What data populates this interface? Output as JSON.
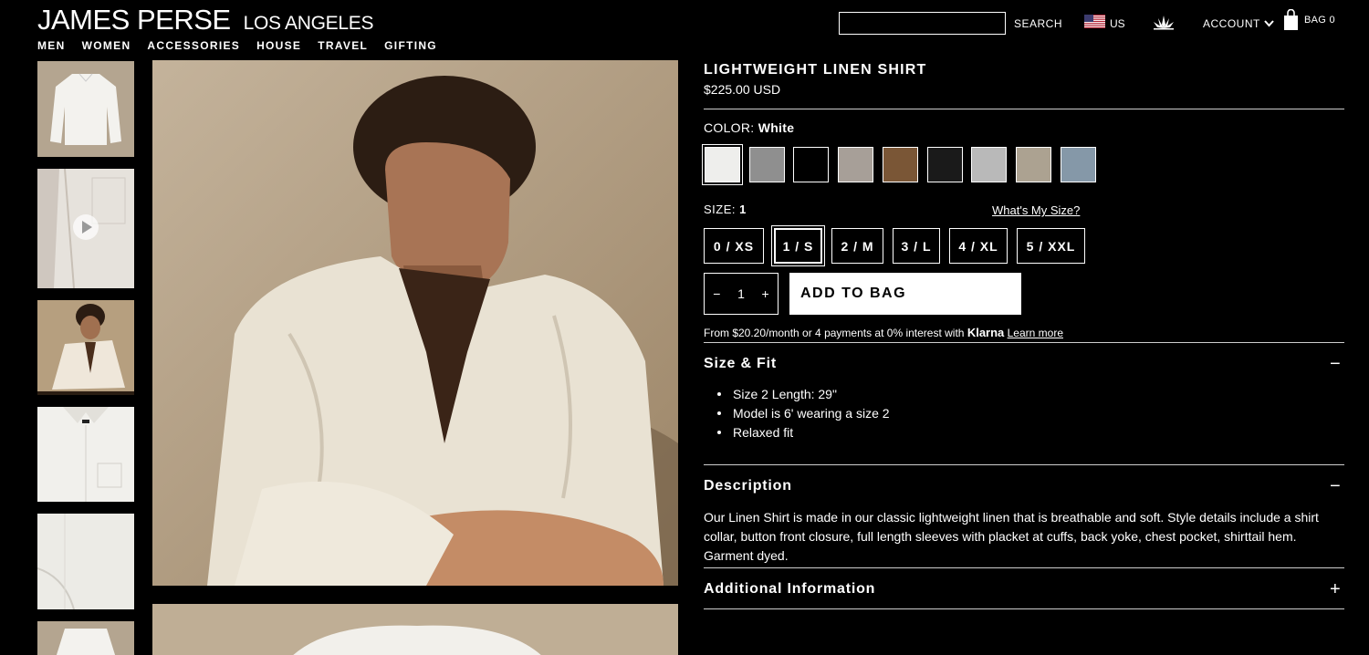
{
  "brand": {
    "name": "JAMES PERSE",
    "sub": "LOS ANGELES"
  },
  "nav": [
    "MEN",
    "WOMEN",
    "ACCESSORIES",
    "HOUSE",
    "TRAVEL",
    "GIFTING"
  ],
  "header": {
    "search_value": "",
    "search_label": "SEARCH",
    "region": "US",
    "account": "ACCOUNT",
    "bag": "BAG 0"
  },
  "product": {
    "title": "LIGHTWEIGHT LINEN SHIRT",
    "price": "$225.00 USD",
    "color_prefix": "COLOR:",
    "color_value": "White",
    "swatches": [
      "#eeeeec",
      "#8f8f8f",
      "#000000",
      "#a79f98",
      "#7a5636",
      "#1a1a1a",
      "#b9b9b9",
      "#aca291",
      "#8598a8"
    ],
    "size_prefix": "SIZE:",
    "size_value": "1",
    "whats_my_size": "What's My Size?",
    "sizes": [
      "0 / XS",
      "1 / S",
      "2 / M",
      "3 / L",
      "4 / XL",
      "5 / XXL"
    ],
    "quantity": "1",
    "add_to_bag": "ADD TO BAG",
    "klarna_text": "From $20.20/month or 4 payments at 0% interest with",
    "klarna_brand": "Klarna",
    "klarna_link": "Learn more"
  },
  "size_fit": {
    "title": "Size & Fit",
    "toggle": "−",
    "items": [
      "Size 2 Length: 29\"",
      "Model is 6' wearing a size 2",
      "Relaxed fit"
    ]
  },
  "description": {
    "title": "Description",
    "toggle": "−",
    "text": "Our Linen Shirt is made in our classic lightweight linen that is breathable and soft. Style details include a shirt collar, button front closure, full length sleeves with placket at cuffs, back yoke, chest pocket, shirttail hem. Garment dyed."
  },
  "additional": {
    "title": "Additional Information",
    "toggle": "+"
  }
}
